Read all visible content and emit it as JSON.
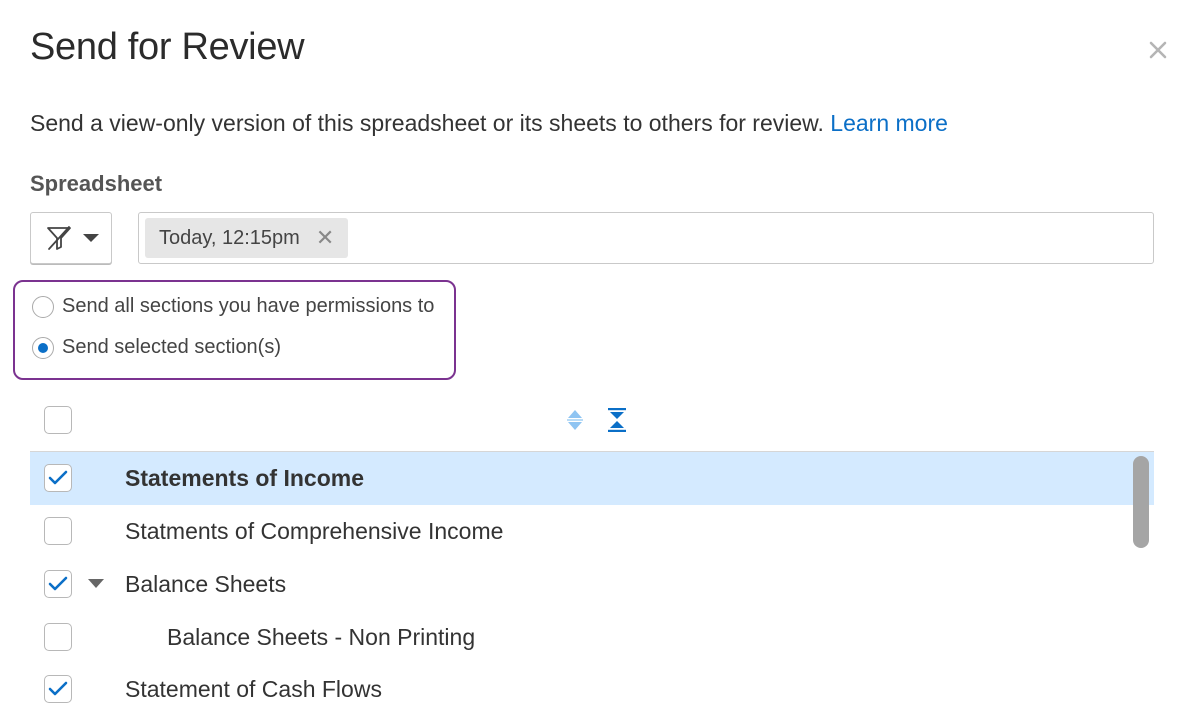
{
  "dialog": {
    "title": "Send for Review",
    "description": "Send a view-only version of this spreadsheet or its sheets to others for review.",
    "learn_more": "Learn more"
  },
  "spreadsheet": {
    "label": "Spreadsheet",
    "filter_icon": "filter-off-icon",
    "token": "Today, 12:15pm"
  },
  "options": {
    "all": "Send all sections you have permissions to",
    "selected": "Send selected section(s)",
    "selected_value": "selected"
  },
  "sections": [
    {
      "label": "Statements of Income",
      "checked": true,
      "highlighted": true,
      "expandable": false,
      "indent": 0
    },
    {
      "label": "Statments of Comprehensive Income",
      "checked": false,
      "highlighted": false,
      "expandable": false,
      "indent": 0
    },
    {
      "label": "Balance Sheets",
      "checked": true,
      "highlighted": false,
      "expandable": true,
      "expanded": true,
      "indent": 0
    },
    {
      "label": "Balance Sheets - Non Printing",
      "checked": false,
      "highlighted": false,
      "expandable": false,
      "indent": 1
    },
    {
      "label": "Statement of Cash Flows",
      "checked": true,
      "highlighted": false,
      "expandable": false,
      "indent": 0
    }
  ],
  "colors": {
    "accent": "#0b6fc7",
    "highlight_row": "#d4eaff",
    "focus_outline": "#7b3390"
  }
}
